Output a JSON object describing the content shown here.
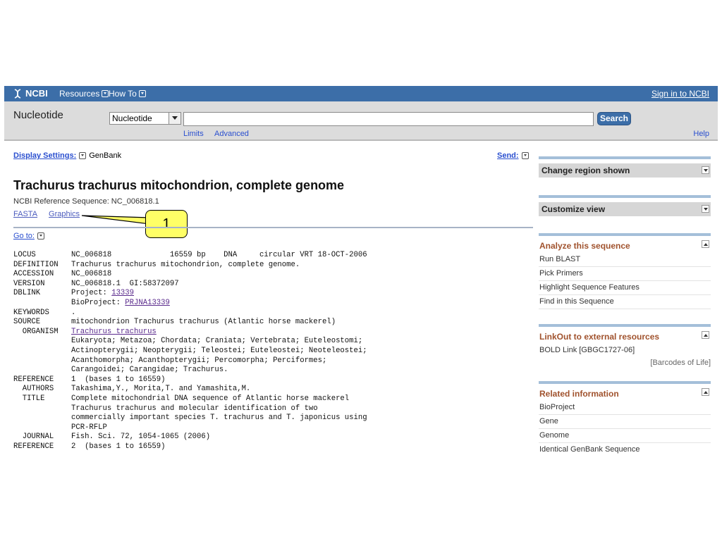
{
  "topbar": {
    "logo": "NCBI",
    "resources": "Resources",
    "howto": "How To",
    "signin": "Sign in to NCBI"
  },
  "search": {
    "db_title": "Nucleotide",
    "db_select": "Nucleotide",
    "query": "",
    "button": "Search",
    "limits": "Limits",
    "advanced": "Advanced",
    "help": "Help"
  },
  "display": {
    "label": "Display Settings:",
    "value": "GenBank",
    "send": "Send:"
  },
  "record": {
    "title": "Trachurus trachurus mitochondrion, complete genome",
    "refseq": "NCBI Reference Sequence: NC_006818.1",
    "fasta": "FASTA",
    "graphics": "Graphics",
    "goto": "Go to:"
  },
  "callout": {
    "label": "1"
  },
  "genbank": [
    {
      "k": "LOCUS",
      "v": "NC_006818             16559 bp    DNA     circular VRT 18-OCT-2006"
    },
    {
      "k": "DEFINITION",
      "v": "Trachurus trachurus mitochondrion, complete genome."
    },
    {
      "k": "ACCESSION",
      "v": "NC_006818"
    },
    {
      "k": "VERSION",
      "v": "NC_006818.1  GI:58372097"
    },
    {
      "k": "DBLINK",
      "v": "Project: ",
      "link": "13339"
    },
    {
      "k": "",
      "v": "BioProject: ",
      "link": "PRJNA13339"
    },
    {
      "k": "KEYWORDS",
      "v": "."
    },
    {
      "k": "SOURCE",
      "v": "mitochondrion Trachurus trachurus (Atlantic horse mackerel)"
    },
    {
      "k": "  ORGANISM",
      "v": "",
      "link": "Trachurus trachurus"
    },
    {
      "k": "",
      "v": "Eukaryota; Metazoa; Chordata; Craniata; Vertebrata; Euteleostomi;"
    },
    {
      "k": "",
      "v": "Actinopterygii; Neopterygii; Teleostei; Euteleostei; Neoteleostei;"
    },
    {
      "k": "",
      "v": "Acanthomorpha; Acanthopterygii; Percomorpha; Perciformes;"
    },
    {
      "k": "",
      "v": "Carangoidei; Carangidae; Trachurus."
    },
    {
      "k": "REFERENCE",
      "v": "1  (bases 1 to 16559)"
    },
    {
      "k": "  AUTHORS",
      "v": "Takashima,Y., Morita,T. and Yamashita,M."
    },
    {
      "k": "  TITLE",
      "v": "Complete mitochondrial DNA sequence of Atlantic horse mackerel"
    },
    {
      "k": "",
      "v": "Trachurus trachurus and molecular identification of two"
    },
    {
      "k": "",
      "v": "commercially important species T. trachurus and T. japonicus using"
    },
    {
      "k": "",
      "v": "PCR-RFLP"
    },
    {
      "k": "  JOURNAL",
      "v": "Fish. Sci. 72, 1054-1065 (2006)"
    },
    {
      "k": "REFERENCE",
      "v": "2  (bases 1 to 16559)"
    }
  ],
  "sidebar": {
    "change_region": "Change region shown",
    "customize_view": "Customize view",
    "analyze": {
      "title": "Analyze this sequence",
      "items": [
        "Run BLAST",
        "Pick Primers",
        "Highlight Sequence Features",
        "Find in this Sequence"
      ]
    },
    "linkout": {
      "title": "LinkOut to external resources",
      "items": [
        "BOLD Link [GBGC1727-06]"
      ],
      "note": "[Barcodes of Life]"
    },
    "related": {
      "title": "Related information",
      "items": [
        "BioProject",
        "Gene",
        "Genome",
        "Identical GenBank Sequence"
      ]
    }
  }
}
